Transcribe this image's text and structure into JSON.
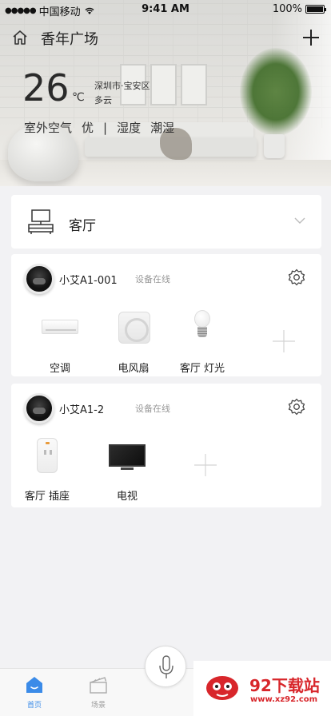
{
  "status_bar": {
    "carrier": "中国移动",
    "time": "9:41 AM",
    "battery": "100%",
    "battery_level": 1.0
  },
  "header": {
    "location": "香年广场",
    "home_icon": "home-icon",
    "add_icon": "plus-icon"
  },
  "weather": {
    "temperature": "26",
    "unit": "℃",
    "city": "深圳市·宝安区",
    "condition": "多云",
    "air_label": "室外空气",
    "air_value": "优",
    "separator": "|",
    "humidity_label": "湿度",
    "humidity_value": "潮湿"
  },
  "room": {
    "name": "客厅",
    "icon": "tv-cabinet-icon"
  },
  "hubs": [
    {
      "name": "小艾A1-001",
      "status": "设备在线",
      "devices": [
        {
          "label": "空调",
          "icon": "air-conditioner-icon"
        },
        {
          "label": "电风扇",
          "icon": "fan-icon"
        },
        {
          "label": "客厅 灯光",
          "icon": "light-bulb-icon"
        }
      ]
    },
    {
      "name": "小艾A1-2",
      "status": "设备在线",
      "devices": [
        {
          "label": "客厅 插座",
          "icon": "socket-icon"
        },
        {
          "label": "电视",
          "icon": "tv-icon"
        }
      ]
    }
  ],
  "tabs": [
    {
      "label": "首页",
      "icon": "home-tab-icon",
      "active": true
    },
    {
      "label": "场景",
      "icon": "scene-clapper-icon",
      "active": false
    }
  ],
  "watermark": {
    "title": "92下载站",
    "url": "www.xz92.com"
  },
  "colors": {
    "accent": "#3b8be8",
    "watermark_red": "#d8262b",
    "background": "#f2f2f4"
  }
}
